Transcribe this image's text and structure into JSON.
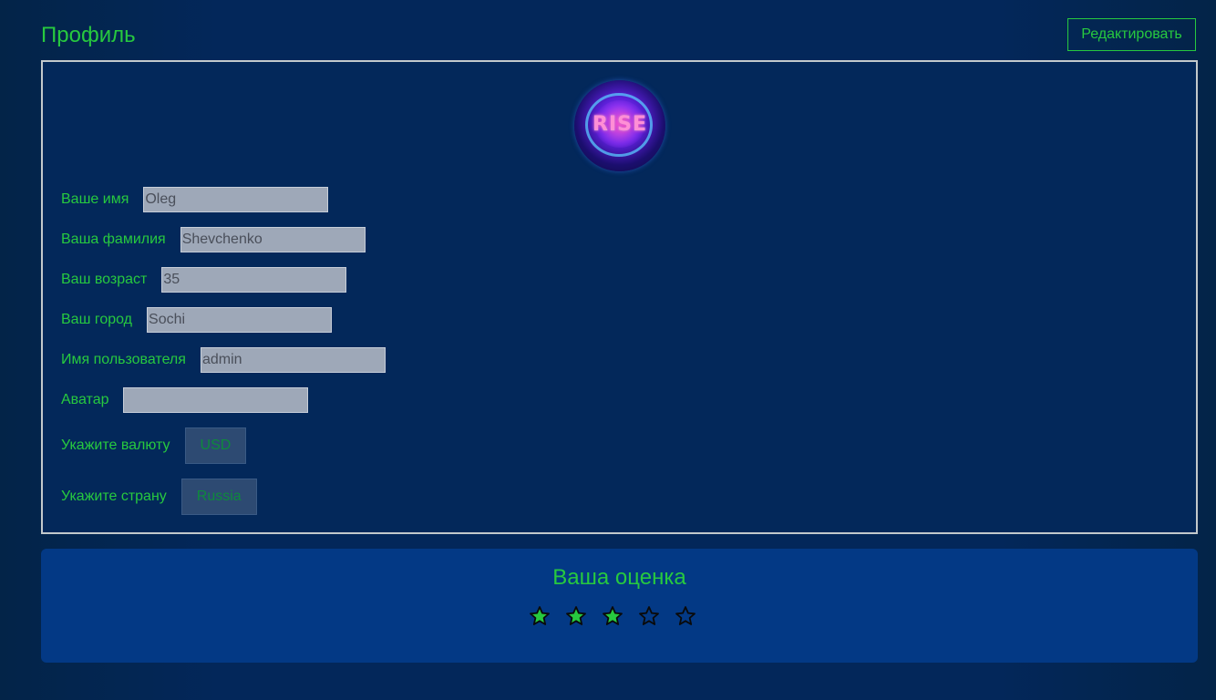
{
  "header": {
    "title": "Профиль",
    "edit_label": "Редактировать"
  },
  "profile": {
    "avatar_icon": "avatar-logo",
    "avatar_text": "RISE",
    "fields": [
      {
        "label": "Ваше имя",
        "value": "Oleg"
      },
      {
        "label": "Ваша фамилия",
        "value": "Shevchenko"
      },
      {
        "label": "Ваш возраст",
        "value": "35"
      },
      {
        "label": "Ваш город",
        "value": "Sochi"
      },
      {
        "label": "Имя пользователя",
        "value": "admin"
      },
      {
        "label": "Аватар",
        "value": ""
      }
    ],
    "currency": {
      "label": "Укажите валюту",
      "value": "USD"
    },
    "country": {
      "label": "Укажите страну",
      "value": "Russia"
    }
  },
  "rating": {
    "title": "Ваша оценка",
    "value": 3,
    "max": 5,
    "filled_color": "#27c93f",
    "empty_color": "#033985",
    "stroke_color": "#0a0a0a"
  }
}
